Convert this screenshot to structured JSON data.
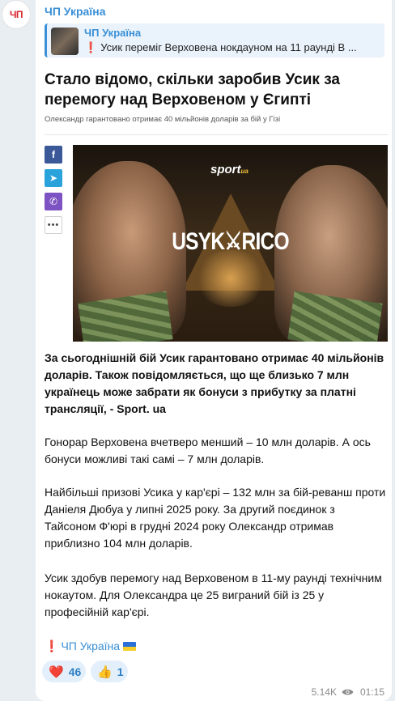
{
  "channel": {
    "avatar_text": "ЧП",
    "name": "ЧП Україна"
  },
  "reply": {
    "title": "ЧП Україна",
    "icon": "❗",
    "text": "Усик переміг Верховена нокдауном на 11 раунді В ..."
  },
  "article": {
    "title": "Стало відомо, скільки заробив Усик за перемогу над Верховеном у Єгипті",
    "subtitle": "Олександр гарантовано отримає 40 мільйонів доларів за бій у Гізі"
  },
  "share": {
    "facebook": "f",
    "telegram": "➤",
    "viber": "✆",
    "more": "•••"
  },
  "poster": {
    "logo": "sport",
    "logo_suffix": "ua",
    "fight_text": "USYK⚔RICO"
  },
  "paragraphs": {
    "p1": "За сьогоднішній бій Усик гарантовано отримає 40 мільйонів доларів. Також повідомляється, що ще близько 7 млн українець може забрати як бонуси з прибутку за платні трансляції, - Sport. ua",
    "p2": "Гонорар Верховена вчетверо менший – 10 млн доларів. А ось бонуси можливі такі самі – 7 млн доларів.",
    "p3": "Найбільші призові Усика у кар'єрі – 132 млн за бій-реванш проти Даніеля Дюбуа у липні 2025 року. За другий поєдинок з Тайсоном Ф'юрі в грудні 2024 року Олександр отримав приблизно 104 млн доларів.",
    "p4": "Усик здобув перемогу над Верховеном в 11-му раунді технічним нокаутом. Для Олександра це 25 виграний бій із 25 у професійній кар'єрі."
  },
  "signature": {
    "icon": "❗",
    "text": "ЧП Україна"
  },
  "reactions": [
    {
      "emoji": "❤️",
      "count": "46"
    },
    {
      "emoji": "👍",
      "count": "1"
    }
  ],
  "meta": {
    "views": "5.14K",
    "time": "01:15"
  }
}
